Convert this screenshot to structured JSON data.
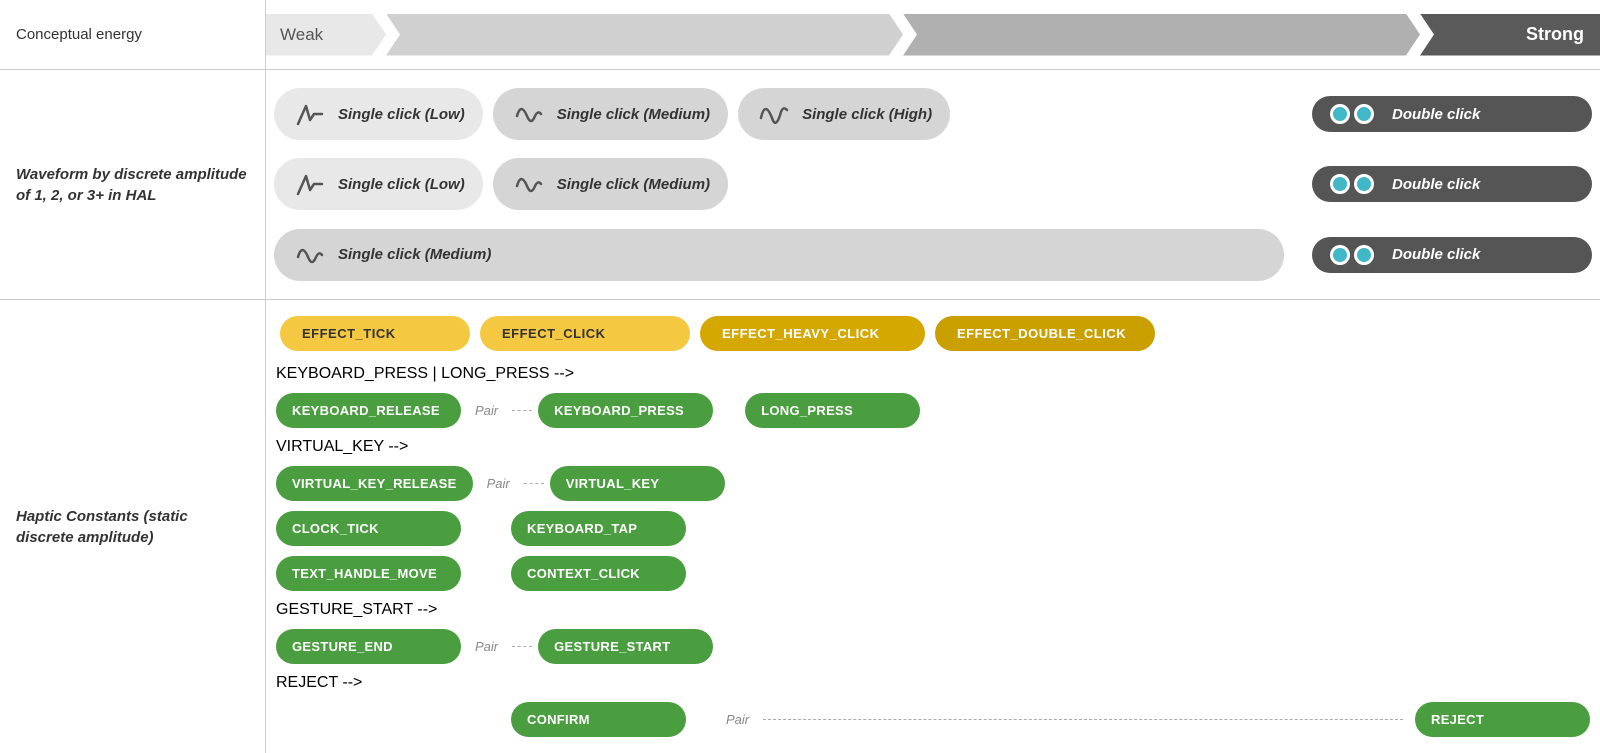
{
  "header": {
    "conceptual_energy_label": "Conceptual energy",
    "weak_label": "Weak",
    "strong_label": "Strong"
  },
  "waveform_section": {
    "label": "Waveform by discrete amplitude of 1, 2, or 3+ in HAL",
    "rows": [
      {
        "pills": [
          {
            "type": "light",
            "icon": "waveform-low",
            "text": "Single click (Low)"
          },
          {
            "type": "medium",
            "icon": "waveform-medium",
            "text": "Single click (Medium)"
          },
          {
            "type": "medium",
            "icon": "waveform-high",
            "text": "Single click (High)"
          },
          {
            "type": "dark",
            "icon": "double-click",
            "text": "Double click"
          }
        ]
      },
      {
        "pills": [
          {
            "type": "light",
            "icon": "waveform-low",
            "text": "Single click (Low)"
          },
          {
            "type": "medium",
            "icon": "waveform-medium",
            "text": "Single click (Medium)"
          },
          {
            "type": "dark",
            "icon": "double-click",
            "text": "Double click"
          }
        ]
      },
      {
        "pills": [
          {
            "type": "medium",
            "icon": "waveform-medium",
            "text": "Single click (Medium)"
          },
          {
            "type": "dark",
            "icon": "double-click",
            "text": "Double click"
          }
        ]
      }
    ]
  },
  "haptic_section": {
    "label": "Haptic Constants (static discrete amplitude)",
    "headers": [
      {
        "id": "tick",
        "text": "EFFECT_TICK",
        "style": "yellow"
      },
      {
        "id": "click",
        "text": "EFFECT_CLICK",
        "style": "yellow"
      },
      {
        "id": "heavy",
        "text": "EFFECT_HEAVY_CLICK",
        "style": "yellow"
      },
      {
        "id": "double",
        "text": "EFFECT_DOUBLE_CLICK",
        "style": "dark-yellow"
      }
    ],
    "rows": [
      {
        "col1": "KEYBOARD_RELEASE",
        "pair1": "Pair",
        "col2": "KEYBOARD_PRESS",
        "col3": "LONG_PRESS",
        "col4": null
      },
      {
        "col1": "VIRTUAL_KEY_RELEASE",
        "pair1": "Pair",
        "col2": "VIRTUAL_KEY",
        "col3": null,
        "col4": null
      },
      {
        "col1": "CLOCK_TICK",
        "col2": "KEYBOARD_TAP",
        "col3": null,
        "col4": null
      },
      {
        "col1": "TEXT_HANDLE_MOVE",
        "col2": "CONTEXT_CLICK",
        "col3": null,
        "col4": null
      },
      {
        "col1": "GESTURE_END",
        "pair1": "Pair",
        "col2": "GESTURE_START",
        "col3": null,
        "col4": null
      },
      {
        "col1": null,
        "col2": "CONFIRM",
        "pair2": "Pair",
        "col3": null,
        "col4": "REJECT"
      }
    ]
  }
}
